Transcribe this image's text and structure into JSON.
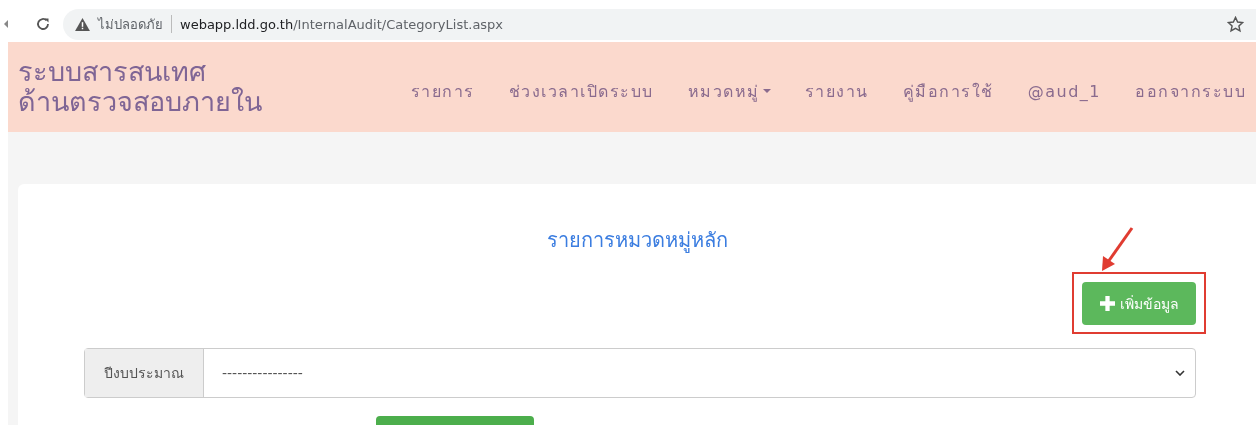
{
  "browser": {
    "security_label": "ไม่ปลอดภัย",
    "url_host": "webapp.ldd.go.th",
    "url_path": "/InternalAudit/CategoryList.aspx"
  },
  "header": {
    "brand_lines": [
      "ระบบสารสนเทศ",
      "ด้านตรวจสอบภายใน"
    ],
    "nav": [
      {
        "label": "รายการ",
        "dropdown": false
      },
      {
        "label": "ช่วงเวลาเปิดระบบ",
        "dropdown": false
      },
      {
        "label": "หมวดหมู่",
        "dropdown": true
      },
      {
        "label": "รายงาน",
        "dropdown": false
      },
      {
        "label": "คู่มือการใช้",
        "dropdown": false
      },
      {
        "label": "@aud_1",
        "dropdown": false
      },
      {
        "label": "ออกจากระบบ",
        "dropdown": false
      }
    ]
  },
  "page": {
    "title": "รายการหมวดหมู่หลัก",
    "add_button": "เพิ่มข้อมูล",
    "filter": {
      "label": "ปีงบประมาณ",
      "value": "----------------"
    }
  }
}
